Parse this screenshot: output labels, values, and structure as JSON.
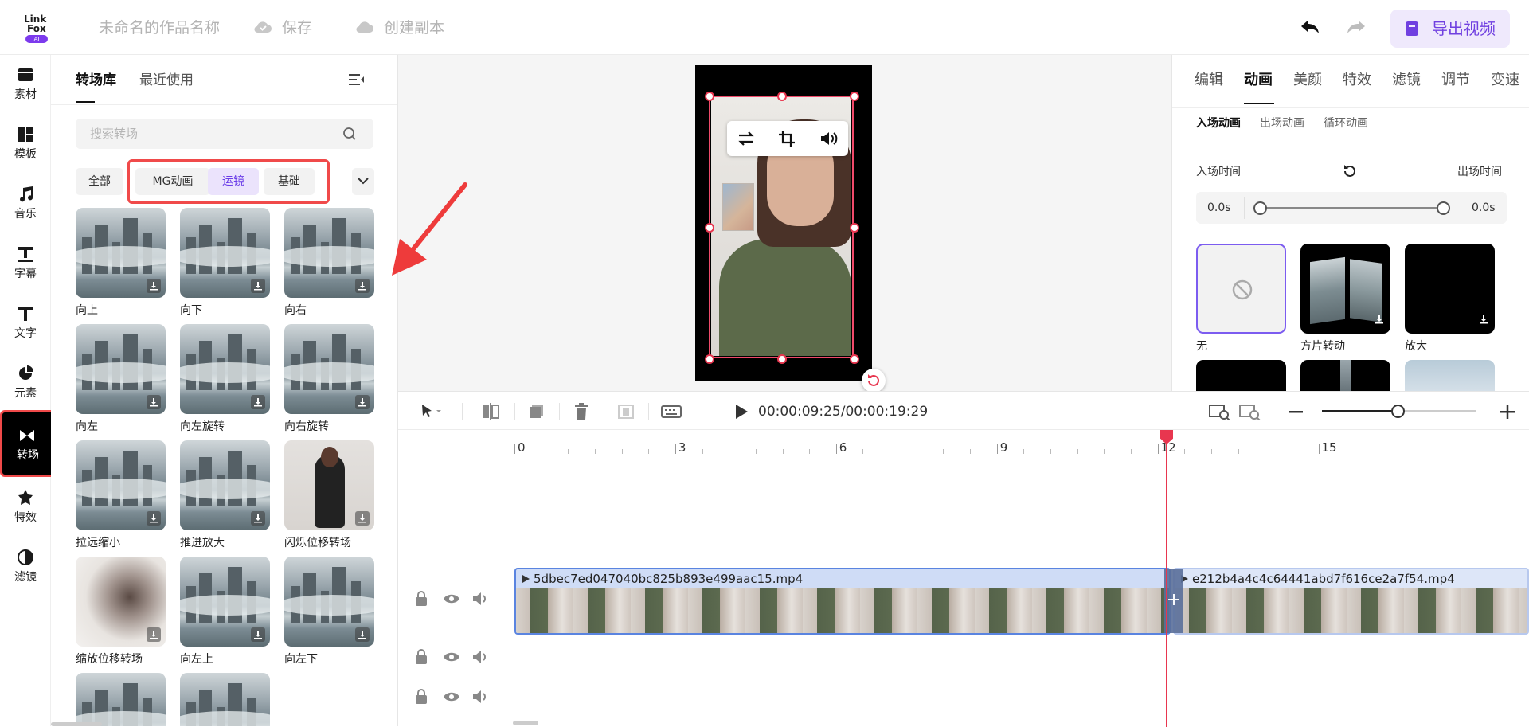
{
  "header": {
    "logo": {
      "line1": "Link",
      "line2": "Fox",
      "badge": "AI"
    },
    "project_name": "未命名的作品名称",
    "save_label": "保存",
    "duplicate_label": "创建副本",
    "export_label": "导出视频"
  },
  "sidebar": {
    "items": [
      {
        "label": "素材",
        "icon": "folder-icon"
      },
      {
        "label": "模板",
        "icon": "template-icon"
      },
      {
        "label": "音乐",
        "icon": "music-icon"
      },
      {
        "label": "字幕",
        "icon": "subtitle-icon"
      },
      {
        "label": "文字",
        "icon": "text-icon"
      },
      {
        "label": "元素",
        "icon": "element-icon"
      },
      {
        "label": "转场",
        "icon": "transition-icon"
      },
      {
        "label": "特效",
        "icon": "effects-icon"
      },
      {
        "label": "滤镜",
        "icon": "filter-icon"
      }
    ],
    "active": "转场"
  },
  "library": {
    "tabs": [
      "转场库",
      "最近使用"
    ],
    "search_placeholder": "搜索转场",
    "categories": [
      "全部",
      "MG动画",
      "运镜",
      "基础"
    ],
    "active_category": "运镜",
    "items": [
      {
        "label": "向上",
        "thumb": "city"
      },
      {
        "label": "向下",
        "thumb": "city"
      },
      {
        "label": "向右",
        "thumb": "city"
      },
      {
        "label": "向左",
        "thumb": "city"
      },
      {
        "label": "向左旋转",
        "thumb": "city"
      },
      {
        "label": "向右旋转",
        "thumb": "city"
      },
      {
        "label": "拉远缩小",
        "thumb": "city"
      },
      {
        "label": "推进放大",
        "thumb": "city"
      },
      {
        "label": "闪烁位移转场",
        "thumb": "woman"
      },
      {
        "label": "缩放位移转场",
        "thumb": "blur"
      },
      {
        "label": "向左上",
        "thumb": "city"
      },
      {
        "label": "向左下",
        "thumb": "city"
      },
      {
        "label": "",
        "thumb": "city"
      },
      {
        "label": "",
        "thumb": "city"
      }
    ]
  },
  "right_panel": {
    "tabs": [
      "编辑",
      "动画",
      "美颜",
      "特效",
      "滤镜",
      "调节",
      "变速"
    ],
    "active_tab": "动画",
    "sub_tabs": [
      "入场动画",
      "出场动画",
      "循环动画"
    ],
    "active_sub_tab": "入场动画",
    "in_time_label": "入场时间",
    "out_time_label": "出场时间",
    "in_value": "0.0s",
    "out_value": "0.0s",
    "animations": [
      {
        "label": "无",
        "style": "none"
      },
      {
        "label": "方片转动",
        "style": "cube"
      },
      {
        "label": "放大",
        "style": "black"
      },
      {
        "label": "",
        "style": "black"
      },
      {
        "label": "",
        "style": "split"
      },
      {
        "label": "",
        "style": "snow"
      }
    ]
  },
  "timeline": {
    "timecode": "00:00:09:25/00:00:19:29",
    "ruler_labels": [
      "0",
      "3",
      "6",
      "9",
      "12",
      "15"
    ],
    "clips": [
      {
        "name": "5dbec7ed047040bc825b893e499aac15.mp4"
      },
      {
        "name": "e212b4a4c4c64441abd7f616ce2a7f54.mp4"
      }
    ],
    "zoom": 0.49
  },
  "colors": {
    "accent": "#7040e0",
    "highlight": "#f04a4a",
    "playhead": "#e8364f",
    "clip_border": "#5a84e0"
  }
}
